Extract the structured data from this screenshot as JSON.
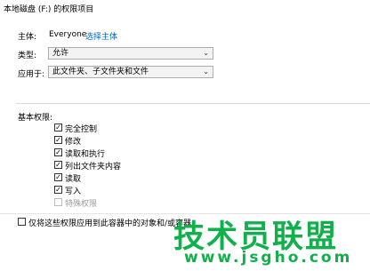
{
  "window": {
    "title": "本地磁盘 (F:) 的权限项目"
  },
  "principal": {
    "label": "主体:",
    "value": "Everyone",
    "select_link": "选择主体"
  },
  "type": {
    "label": "类型:",
    "value": "允许"
  },
  "applies_to": {
    "label": "应用于:",
    "value": "此文件夹、子文件夹和文件"
  },
  "permissions": {
    "title": "基本权限:",
    "items": [
      {
        "label": "完全控制",
        "checked": true,
        "disabled": false
      },
      {
        "label": "修改",
        "checked": true,
        "disabled": false
      },
      {
        "label": "读取和执行",
        "checked": true,
        "disabled": false
      },
      {
        "label": "列出文件夹内容",
        "checked": true,
        "disabled": false
      },
      {
        "label": "读取",
        "checked": true,
        "disabled": false
      },
      {
        "label": "写入",
        "checked": true,
        "disabled": false
      },
      {
        "label": "特殊权限",
        "checked": false,
        "disabled": true
      }
    ]
  },
  "apply_only": {
    "label": "仅将这些权限应用到此容器中的对象和/或容器",
    "checked": false
  },
  "watermark": {
    "main": "技术员联盟",
    "url": "www.jsgho.com"
  },
  "icons": {
    "folder": "folder-icon",
    "dropdown": "chevron-down-icon",
    "check": "checkmark-icon"
  },
  "colors": {
    "link": "#0066cc",
    "watermark": "#10b04a"
  }
}
